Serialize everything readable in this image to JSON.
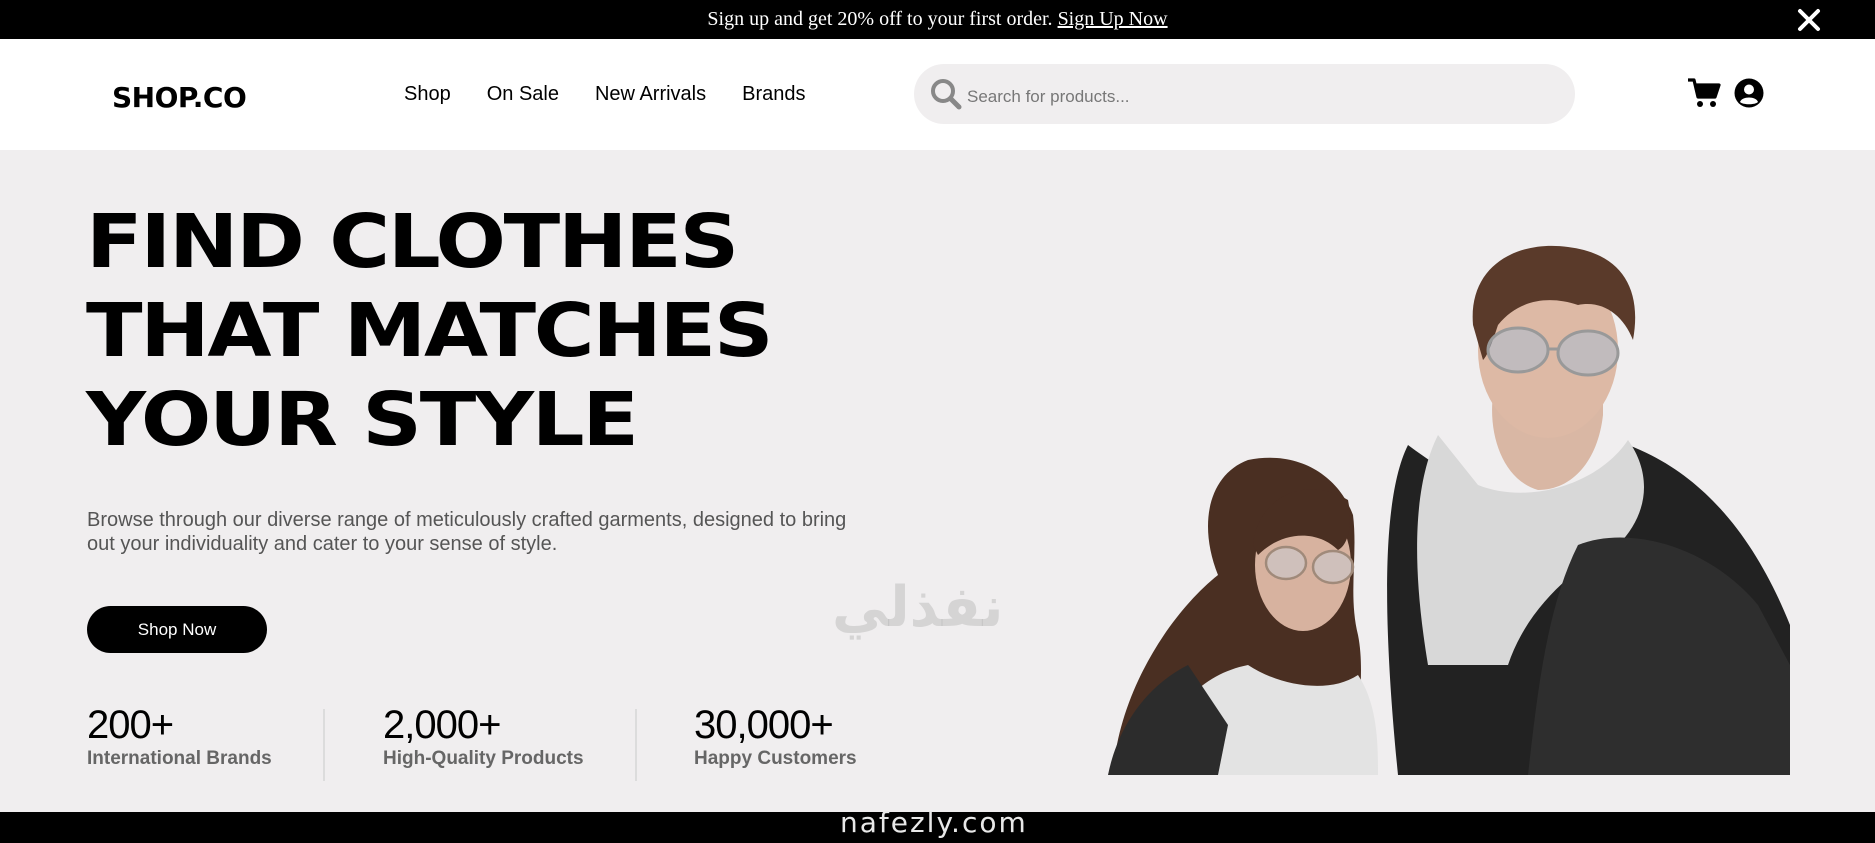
{
  "announcement": {
    "text": "Sign up and get 20% off to your first order.",
    "link": "Sign Up Now",
    "close_icon": "close-icon"
  },
  "header": {
    "logo": "SHOP.CO",
    "nav": [
      "Shop",
      "On Sale",
      "New Arrivals",
      "Brands"
    ],
    "search_placeholder": "Search for products...",
    "search_icon": "search-icon",
    "cart_icon": "cart-icon",
    "account_icon": "user-circle-icon"
  },
  "hero": {
    "headline": [
      "FIND CLOTHES",
      "THAT MATCHES",
      "YOUR STYLE"
    ],
    "description_1": "Browse through our diverse range of meticulously crafted garments, designed to bring",
    "description_2": "out your individuality and cater to your sense of style.",
    "cta": "Shop Now",
    "stats": [
      {
        "value": "200+",
        "label": "International Brands"
      },
      {
        "value": "2,000+",
        "label": "High-Quality Products"
      },
      {
        "value": "30,000+",
        "label": "Happy Customers"
      }
    ]
  },
  "watermark": {
    "arabic": "نفذلي",
    "latin": "nafezly.com"
  },
  "colors": {
    "primary": "#000000",
    "hero_bg": "#f0eeef",
    "muted_text": "#666666"
  }
}
